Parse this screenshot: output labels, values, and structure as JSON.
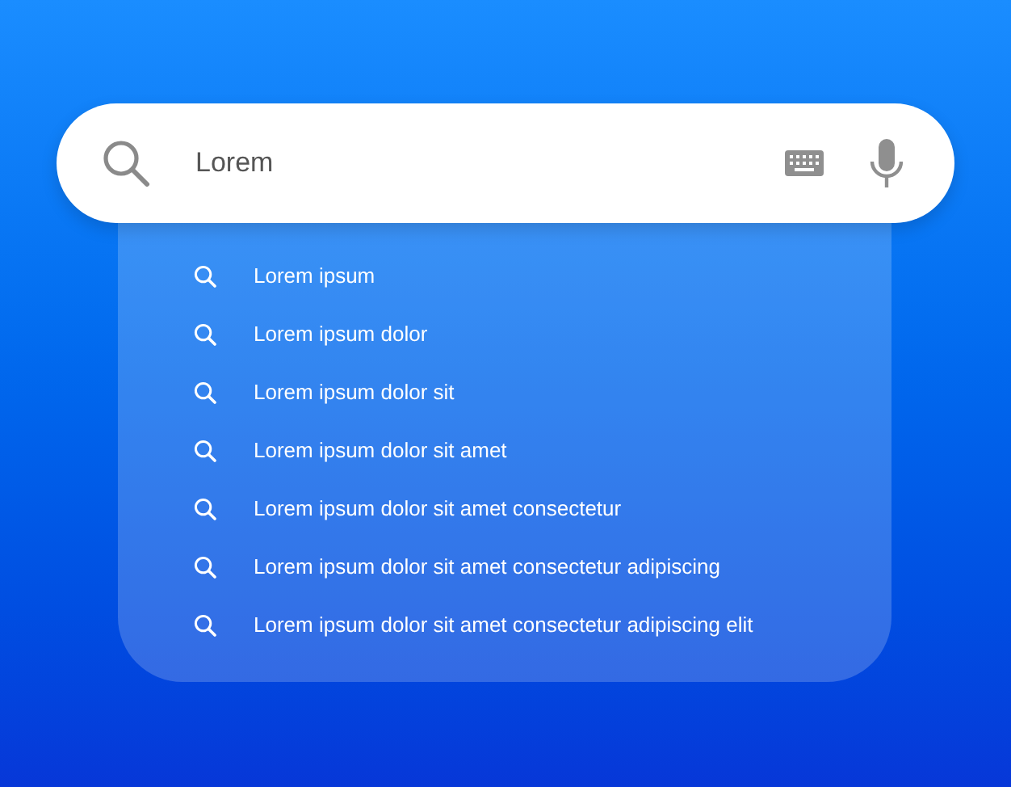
{
  "search": {
    "value": "Lorem"
  },
  "suggestions": [
    {
      "text": "Lorem ipsum"
    },
    {
      "text": "Lorem ipsum dolor"
    },
    {
      "text": "Lorem ipsum dolor sit"
    },
    {
      "text": "Lorem ipsum dolor sit amet"
    },
    {
      "text": "Lorem ipsum dolor sit amet consectetur"
    },
    {
      "text": "Lorem ipsum dolor sit amet consectetur adipiscing"
    },
    {
      "text": "Lorem ipsum dolor sit amet consectetur adipiscing elit"
    }
  ]
}
